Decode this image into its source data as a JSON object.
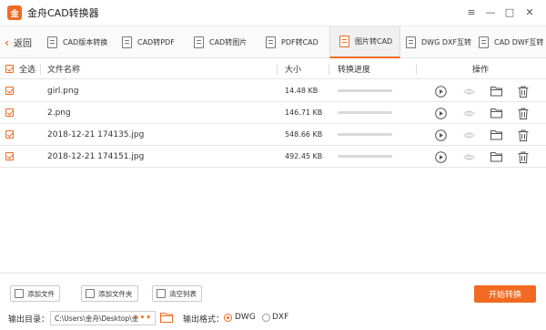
{
  "app": {
    "logo_text": "金",
    "title": "金舟CAD转换器"
  },
  "window_controls": {
    "menu": "≡",
    "minimize": "—",
    "maximize": "□",
    "close": "✕"
  },
  "tabbar": {
    "back_label": "返回",
    "tabs": [
      {
        "label": "CAD版本转换"
      },
      {
        "label": "CAD转PDF"
      },
      {
        "label": "CAD转图片"
      },
      {
        "label": "PDF转CAD"
      },
      {
        "label": "图片转CAD",
        "active": true
      },
      {
        "label": "DWG DXF互转"
      },
      {
        "label": "CAD DWF互转"
      }
    ]
  },
  "table": {
    "headers": {
      "select_all": "全选",
      "name": "文件名称",
      "size": "大小",
      "progress": "转换进度",
      "actions": "操作"
    },
    "rows": [
      {
        "name": "girl.png",
        "size": "14.48 KB",
        "progress": 0
      },
      {
        "name": "2.png",
        "size": "146.71 KB",
        "progress": 0
      },
      {
        "name": "2018-12-21 174135.jpg",
        "size": "548.66 KB",
        "progress": 0
      },
      {
        "name": "2018-12-21 174151.jpg",
        "size": "492.45 KB",
        "progress": 0
      }
    ]
  },
  "bottom": {
    "add_file": "添加文件",
    "add_folder": "添加文件夹",
    "clear_list": "清空列表",
    "start": "开始转换",
    "output_dir_label": "输出目录：",
    "output_dir_value": "C:\\Users\\金舟\\Desktop\\金",
    "browse_dots": "•••",
    "format_label": "输出格式：",
    "format_options": [
      "DWG",
      "DXF"
    ],
    "format_selected": "DWG"
  },
  "colors": {
    "accent": "#f26a21",
    "border": "#e3e3e3"
  }
}
